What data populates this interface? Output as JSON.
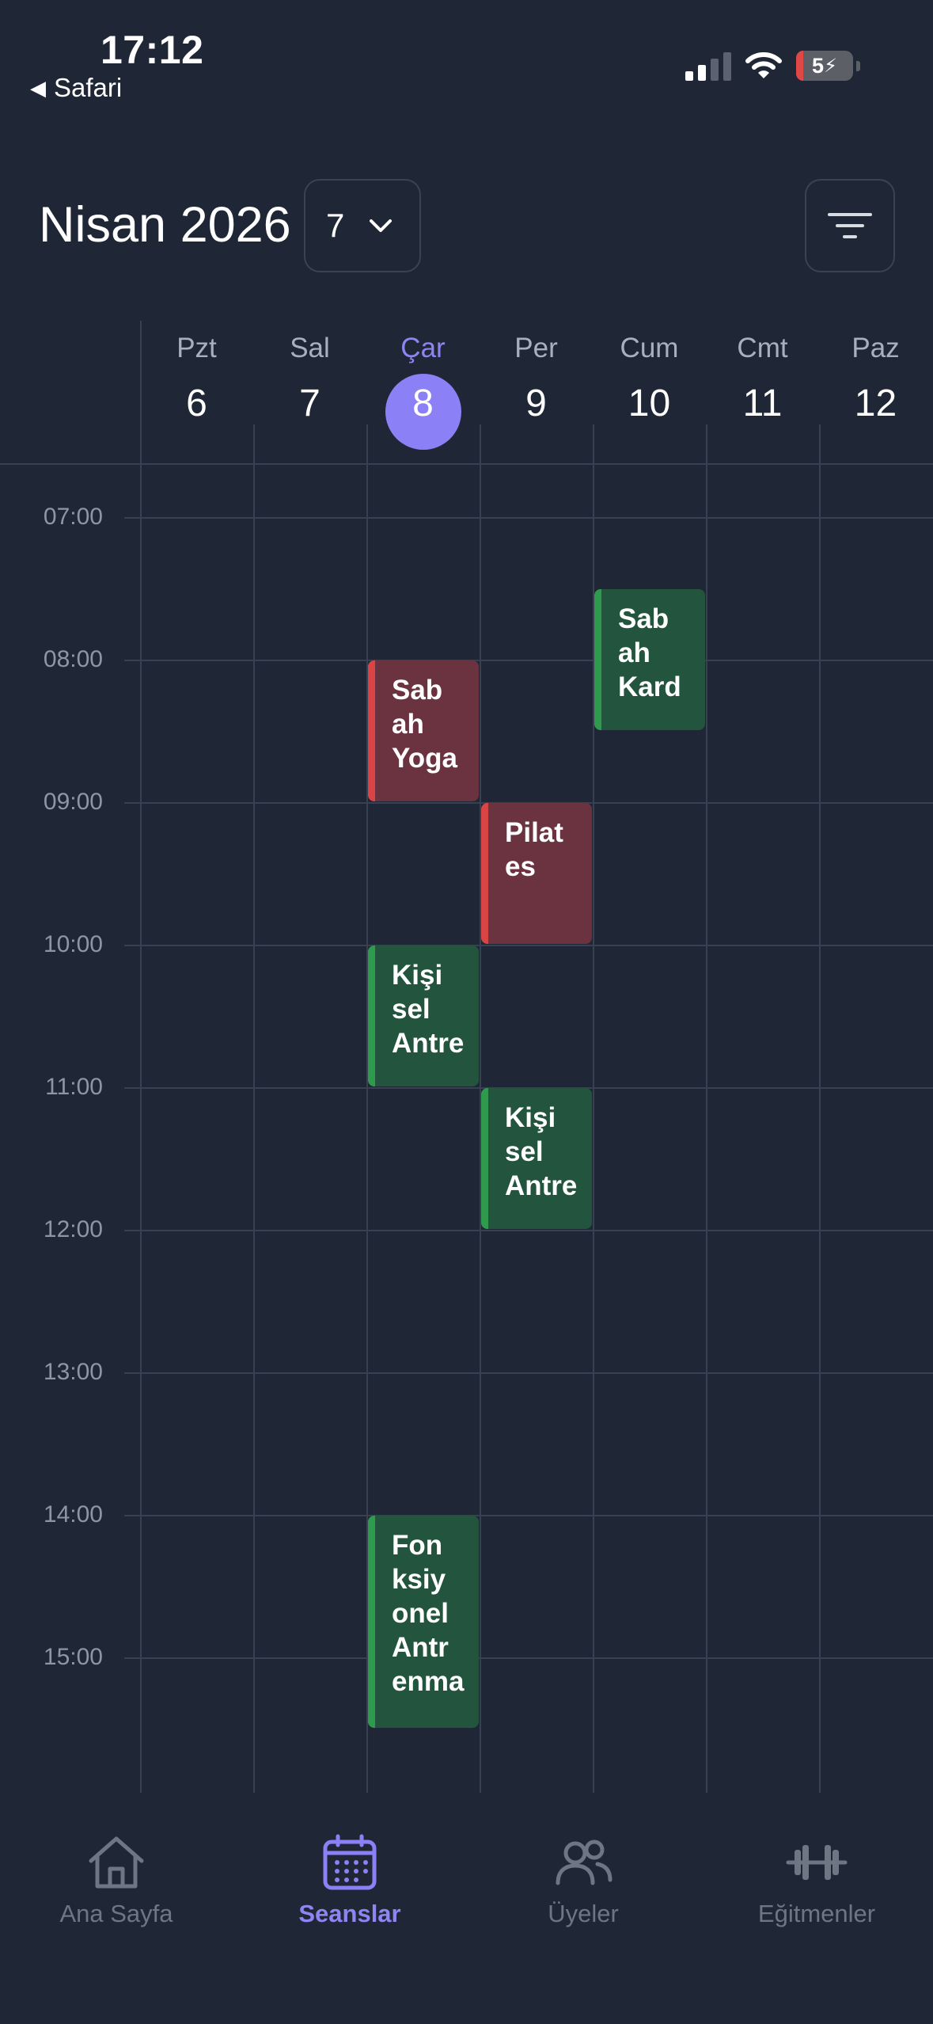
{
  "status_bar": {
    "time": "17:12",
    "back_app": "Safari",
    "battery": "5"
  },
  "header": {
    "month_title": "Nisan 2026",
    "week_select_value": "7"
  },
  "days": [
    {
      "name": "Pzt",
      "date": "6",
      "today": false
    },
    {
      "name": "Sal",
      "date": "7",
      "today": false
    },
    {
      "name": "Çar",
      "date": "8",
      "today": true
    },
    {
      "name": "Per",
      "date": "9",
      "today": false
    },
    {
      "name": "Cum",
      "date": "10",
      "today": false
    },
    {
      "name": "Cmt",
      "date": "11",
      "today": false
    },
    {
      "name": "Paz",
      "date": "12",
      "today": false
    }
  ],
  "hours": [
    "07:00",
    "08:00",
    "09:00",
    "10:00",
    "11:00",
    "12:00",
    "13:00",
    "14:00",
    "15:00"
  ],
  "events": [
    {
      "title": "Sab\nah\nKard",
      "day_index": 4,
      "start": "07:30",
      "end": "08:30",
      "color": "green"
    },
    {
      "title": "Sab\nah\nYoga",
      "day_index": 2,
      "start": "08:00",
      "end": "09:00",
      "color": "red"
    },
    {
      "title": "Pilat\nes",
      "day_index": 3,
      "start": "09:00",
      "end": "10:00",
      "color": "red"
    },
    {
      "title": "Kişi\nsel\nAntre",
      "day_index": 2,
      "start": "10:00",
      "end": "11:00",
      "color": "green"
    },
    {
      "title": "Kişi\nsel\nAntre",
      "day_index": 3,
      "start": "11:00",
      "end": "12:00",
      "color": "green"
    },
    {
      "title": "Fon\nksiy\nonel\nAntr\nenma",
      "day_index": 2,
      "start": "14:00",
      "end": "15:30",
      "color": "green"
    }
  ],
  "tabs": [
    {
      "label": "Ana Sayfa",
      "icon": "home-icon",
      "active": false
    },
    {
      "label": "Seanslar",
      "icon": "calendar-icon",
      "active": true
    },
    {
      "label": "Üyeler",
      "icon": "users-icon",
      "active": false
    },
    {
      "label": "Eğitmenler",
      "icon": "dumbbell-icon",
      "active": false
    }
  ],
  "colors": {
    "accent": "#8b80f5",
    "background": "#1f2736",
    "event_red": "#6b3340",
    "event_green": "#23543d"
  }
}
